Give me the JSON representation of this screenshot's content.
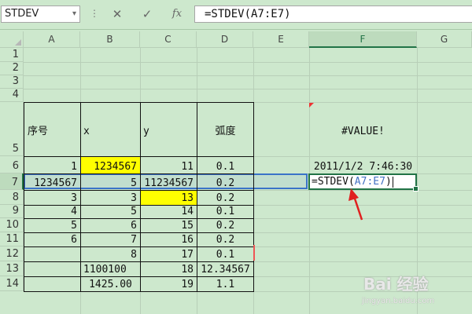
{
  "toolbar": {
    "name_box": "STDEV",
    "name_box_arrow": "▾",
    "more_glyph": "⋮",
    "cancel_glyph": "✕",
    "enter_glyph": "✓",
    "function_glyph": "fx",
    "formula": "=STDEV(A7:E7)"
  },
  "columns": [
    "A",
    "B",
    "C",
    "D",
    "E",
    "F",
    "G"
  ],
  "selected_column": "F",
  "rows": [
    "1",
    "2",
    "3",
    "4",
    "5",
    "6",
    "7",
    "8",
    "9",
    "10",
    "11",
    "12",
    "13",
    "14"
  ],
  "selected_row": "7",
  "cells": {
    "A5": "序号",
    "B5": "x",
    "C5": "y",
    "D5": "弧度",
    "F5": "#VALUE!",
    "A6": "1",
    "B6": "1234567",
    "C6": "11",
    "D6": "0.1",
    "F6": "2011/1/2 7:46:30",
    "A7": "1234567",
    "B7": "5",
    "C7": "11234567",
    "D7": "0.2",
    "A8": "3",
    "B8": "3",
    "C8": "13",
    "D8": "0.2",
    "A9": "4",
    "B9": "5",
    "C9": "14",
    "D9": "0.1",
    "A10": "5",
    "B10": "6",
    "C10": "15",
    "D10": "0.2",
    "A11": "6",
    "B11": "7",
    "C11": "16",
    "D11": "0.2",
    "A12": "",
    "B12": "8",
    "C12": "17",
    "D12": "0.1",
    "B13": "1100100",
    "C13": "18",
    "D13": "12.34567",
    "B14": "1425.00",
    "C14": "19",
    "D14": "1.1"
  },
  "edit_cell": {
    "prefix": "=STDEV(",
    "ref": "A7:E7",
    "suffix": ")"
  },
  "colors": {
    "background": "#cde8cd",
    "highlight": "#ffff00",
    "selection": "#3a73c8",
    "active_border": "#217346",
    "reference": "#4472c4",
    "annotation_arrow": "#e02020"
  },
  "watermark": {
    "text": "Bai 经验",
    "url": "jingyan.baidu.com"
  }
}
